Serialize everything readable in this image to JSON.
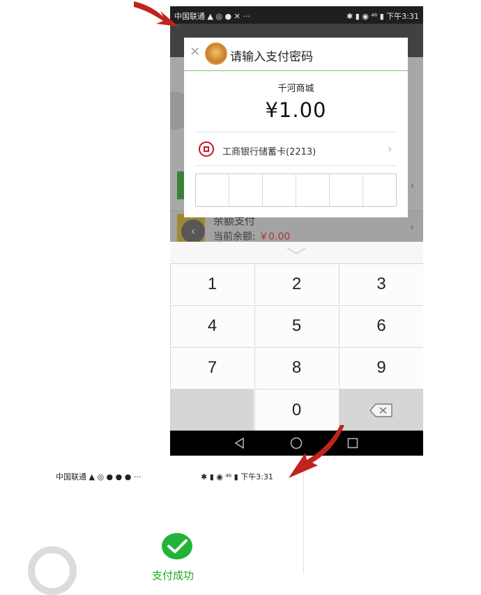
{
  "status_bar": {
    "carrier": "中国联通",
    "left_icons": "▲ ◎ ● ✕ ···",
    "right_icons": "✱ ▮ ◉ ⁴⁶ ▮",
    "time": "下午3:31"
  },
  "dialog": {
    "close_icon": "×",
    "title": "请输入支付密码",
    "merchant": "千河商城",
    "amount": "¥1.00",
    "bank_label": "工商银行储蓄卡(2213)",
    "bank_arrow": "›"
  },
  "background_page": {
    "balance_title": "余额支付",
    "balance_label": "当前余额:",
    "balance_value": "￥0.00",
    "back_button": "‹"
  },
  "keypad": {
    "keys": [
      "1",
      "2",
      "3",
      "4",
      "5",
      "6",
      "7",
      "8",
      "9",
      "0"
    ],
    "delete_icon": "backspace-icon"
  },
  "bottom_screenshot": {
    "carrier": "中国联通",
    "left_icons": "▲ ◎ ● ● ● ···",
    "right_icons": "✱ ▮ ◉ ⁴⁶ ▮",
    "time": "下午3:31",
    "success_text": "支付成功"
  },
  "colors": {
    "annotation_arrow": "#c0241c",
    "wechat_green": "#1aad19",
    "accent_line": "#7ac56b"
  }
}
